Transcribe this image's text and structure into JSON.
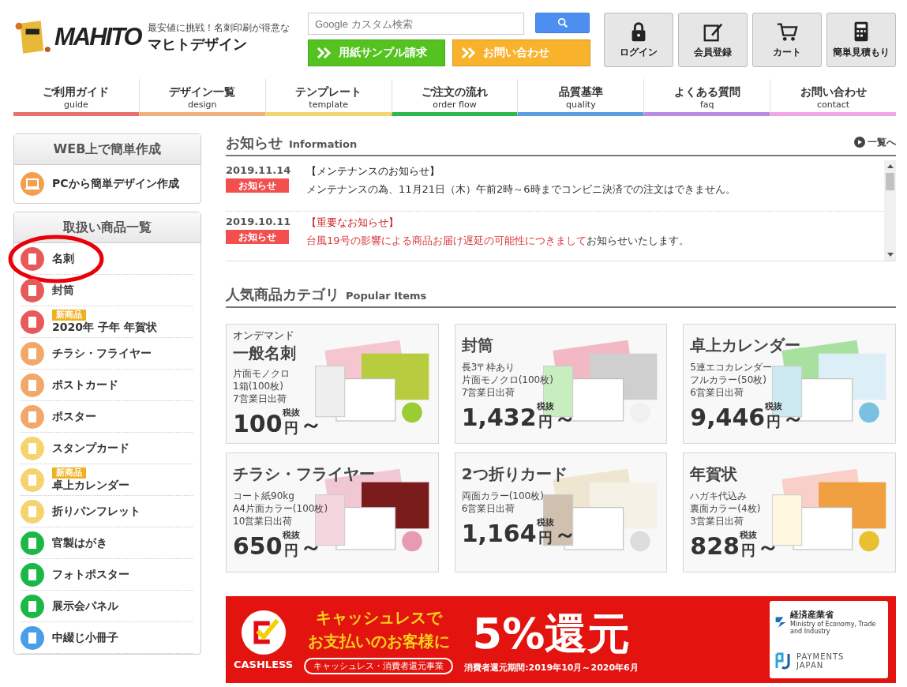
{
  "header": {
    "tagline": "最安値に挑戦！名刺印刷が得意な",
    "logo_text": "MAHITO",
    "brand": "マヒトデザイン",
    "search": {
      "placeholder": "Google カスタム検索"
    },
    "promo_buttons": [
      {
        "label": "用紙サンプル請求",
        "kind": "sample"
      },
      {
        "label": "お問い合わせ",
        "kind": "contact"
      }
    ],
    "icon_buttons": [
      {
        "label": "ログイン",
        "kind": "lock"
      },
      {
        "label": "会員登録",
        "kind": "edit"
      },
      {
        "label": "カート",
        "kind": "cart"
      },
      {
        "label": "簡単見積もり",
        "kind": "calc"
      }
    ]
  },
  "nav": [
    {
      "label": "ご利用ガイド",
      "sub": "guide",
      "color": "#e8706e"
    },
    {
      "label": "デザイン一覧",
      "sub": "design",
      "color": "#f0b07a"
    },
    {
      "label": "テンプレート",
      "sub": "template",
      "color": "#f2d66f"
    },
    {
      "label": "ご注文の流れ",
      "sub": "order flow",
      "color": "#2fb84a"
    },
    {
      "label": "品質基準",
      "sub": "quality",
      "color": "#5a9de0"
    },
    {
      "label": "よくある質問",
      "sub": "faq",
      "color": "#b98ce0"
    },
    {
      "label": "お問い合わせ",
      "sub": "contact",
      "color": "#f2a6e6"
    }
  ],
  "sidebar": {
    "web_box": {
      "title": "WEB上で簡単作成",
      "item": "PCから簡単デザイン作成"
    },
    "products": {
      "title": "取扱い商品一覧",
      "items": [
        {
          "label": "名刺",
          "color": "#e85a5a",
          "circled": true
        },
        {
          "label": "封筒",
          "color": "#e85a5a",
          "circled": false
        },
        {
          "label": "2020年 子年 年賀状",
          "color": "#e85a5a",
          "badge": "新商品",
          "circled": false
        },
        {
          "label": "チラシ・フライヤー",
          "color": "#f2a86a",
          "circled": false
        },
        {
          "label": "ポストカード",
          "color": "#f2a86a",
          "circled": false
        },
        {
          "label": "ポスター",
          "color": "#f2a86a",
          "circled": false
        },
        {
          "label": "スタンプカード",
          "color": "#f5d470",
          "circled": false
        },
        {
          "label": "卓上カレンダー",
          "color": "#f5d470",
          "badge": "新商品",
          "circled": false
        },
        {
          "label": "折りパンフレット",
          "color": "#f5d470",
          "circled": false
        },
        {
          "label": "官製はがき",
          "color": "#1bb847",
          "circled": false
        },
        {
          "label": "フォトポスター",
          "color": "#1bb847",
          "circled": false
        },
        {
          "label": "展示会パネル",
          "color": "#1bb847",
          "circled": false
        },
        {
          "label": "中綴じ小冊子",
          "color": "#4a9de8",
          "circled": false
        }
      ]
    }
  },
  "news": {
    "title": "お知らせ",
    "subtitle": "Information",
    "more": "一覧へ",
    "items": [
      {
        "date": "2019.11.14",
        "tag": "お知らせ",
        "title": "【メンテナンスのお知らせ】",
        "important": false,
        "body": [
          {
            "text": "メンテナンスの為、11月21日（木）午前2時～6時までコンビニ決済での注文はできません。",
            "emphasis": false
          }
        ]
      },
      {
        "date": "2019.10.11",
        "tag": "お知らせ",
        "title": "【重要なお知らせ】",
        "important": true,
        "body": [
          {
            "text": "台風19号の影響による商品お届け遅延の可能性につきまして",
            "emphasis": true
          },
          {
            "text": "お知らせいたします。",
            "emphasis": false
          }
        ]
      }
    ]
  },
  "popular": {
    "title": "人気商品カテゴリ",
    "subtitle": "Popular Items",
    "cards": [
      {
        "pre": "オンデマンド",
        "name": "一般名刺",
        "details": [
          "片面モノクロ",
          "1箱(100枚)",
          "7営業日出荷"
        ],
        "price": "100",
        "unit": "円",
        "tax": "税抜",
        "tilde": "～"
      },
      {
        "name": "封筒",
        "details": [
          "長3〒枠あり",
          "片面モノクロ(100枚)",
          "7営業日出荷"
        ],
        "price": "1,432",
        "unit": "円",
        "tax": "税抜",
        "tilde": "～"
      },
      {
        "name": "卓上カレンダー",
        "details": [
          "5連エコカレンダー",
          "フルカラー(50枚)",
          "6営業日出荷"
        ],
        "price": "9,446",
        "unit": "円",
        "tax": "税抜",
        "tilde": "～"
      },
      {
        "name": "チラシ・フライヤー",
        "details": [
          "コート紙90kg",
          "A4片面カラー(100枚)",
          "10営業日出荷"
        ],
        "price": "650",
        "unit": "円",
        "tax": "税抜",
        "tilde": "～"
      },
      {
        "name": "2つ折りカード",
        "details": [
          "両面カラー(100枚)",
          "6営業日出荷"
        ],
        "price": "1,164",
        "unit": "円",
        "tax": "税抜",
        "tilde": "～"
      },
      {
        "name": "年賀状",
        "details": [
          "ハガキ代込み",
          "裏面カラー(4枚)",
          "3営業日出荷"
        ],
        "price": "828",
        "unit": "円",
        "tax": "税抜",
        "tilde": "～"
      }
    ]
  },
  "banner": {
    "cashless": "CASHLESS",
    "headline": [
      "キャッシュレスで",
      "お支払いのお客様に"
    ],
    "program": "キャッシュレス・消費者還元事業",
    "big": "5%還元",
    "period": "消費者還元期間:2019年10月～2020年6月",
    "ministry": "経済産業省",
    "ministry_en": "Ministry of Economy, Trade and Industry",
    "payments": [
      "PAYMENTS",
      "JAPAN"
    ]
  }
}
